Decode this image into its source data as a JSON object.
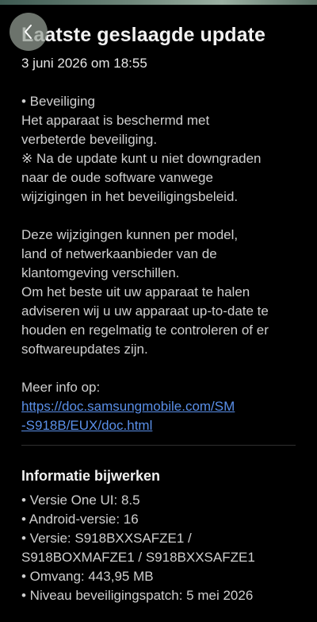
{
  "header": {
    "title": "Laatste geslaagde update",
    "date": "3 juni 2026 om 18:55",
    "back_icon": "chevron-left-icon"
  },
  "content": {
    "security_heading": "• Beveiliging",
    "security_text": "Het apparaat is beschermd met\nverbeterde beveiliging.",
    "downgrade_note": "※ Na de update kunt u niet downgraden\nnaar de oude software vanwege\nwijzigingen in het beveiligingsbeleid.",
    "changes_text": "Deze wijzigingen kunnen per model,\nland of netwerkaanbieder van de\nklantomgeving verschillen.",
    "advice_text": "Om het beste uit uw apparaat te halen\nadviseren wij u uw apparaat up-to-date te\nhouden en regelmatig te controleren of er\nsoftwareupdates zijn.",
    "more_info_label": "Meer info op:",
    "more_info_link": "https://doc.samsungmobile.com/SM\n-S918B/EUX/doc.html"
  },
  "info": {
    "title": "Informatie bijwerken",
    "items": [
      "• Versie One UI: 8.5",
      "• Android-versie: 16",
      "• Versie: S918BXXSAFZE1 /\n  S918BOXMAFZE1 / S918BXXSAFZE1",
      "• Omvang: 443,95 MB",
      "• Niveau beveiligingspatch: 5 mei 2026"
    ]
  },
  "colors": {
    "background": "#000000",
    "text": "#cfcfcf",
    "link": "#5a8fe8"
  }
}
